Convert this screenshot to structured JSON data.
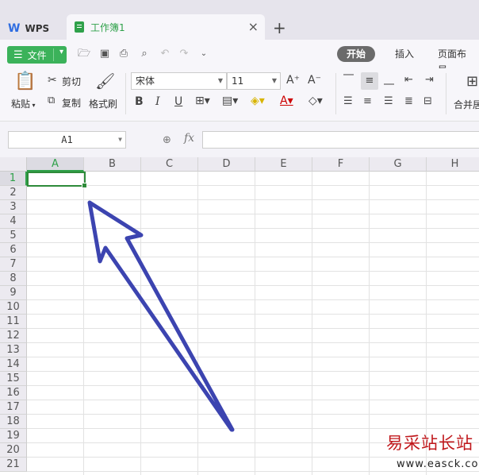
{
  "titlebar": {
    "app_tab": "WPS",
    "doc_tab": "工作簿1",
    "close_glyph": "×",
    "add_glyph": "+"
  },
  "toolbar": {
    "file_label": "文件",
    "tabs": [
      "开始",
      "插入",
      "页面布局"
    ],
    "active_tab": "开始"
  },
  "ribbon": {
    "paste": "粘贴",
    "cut": "剪切",
    "copy": "复制",
    "format_painter": "格式刷",
    "font_name": "宋体",
    "font_size": "11",
    "merge": "合并居"
  },
  "formula_bar": {
    "cell_ref": "A1",
    "fx_label": "fx",
    "formula": ""
  },
  "grid": {
    "columns": [
      "A",
      "B",
      "C",
      "D",
      "E",
      "F",
      "G",
      "H"
    ],
    "rows": [
      "1",
      "2",
      "3",
      "4",
      "5",
      "6",
      "7",
      "8",
      "9",
      "10",
      "11",
      "12",
      "13",
      "14",
      "15",
      "16",
      "17",
      "18",
      "19",
      "20",
      "21"
    ],
    "selected_column": "A",
    "selected_row": "1"
  },
  "watermark": {
    "name": "易采站长站",
    "url": "www.easck.com"
  },
  "colors": {
    "accent_green": "#3bb25a",
    "arrow_blue": "#3c44b0",
    "watermark_red": "#c0181c"
  }
}
